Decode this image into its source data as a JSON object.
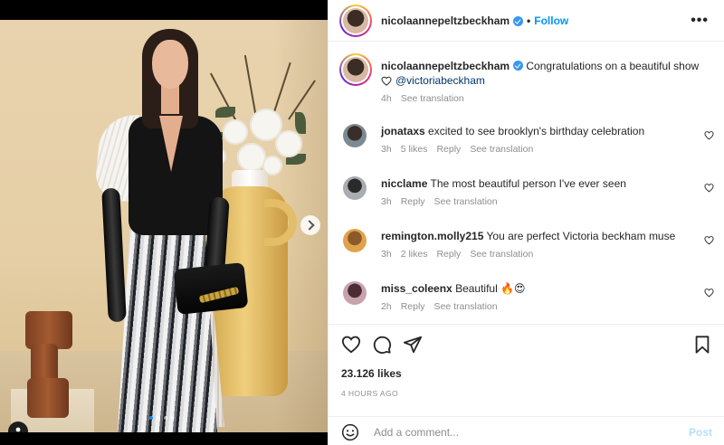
{
  "post": {
    "author": "nicolaannepeltzbeckham",
    "follow_label": "Follow",
    "separator": "•",
    "more_label": "•••",
    "carousel": {
      "total_slides": 4,
      "active_slide": 1
    }
  },
  "caption": {
    "username": "nicolaannepeltzbeckham",
    "text": "Congratulations on a beautiful show",
    "mention": "@victoriabeckham",
    "time": "4h",
    "see_translation": "See translation"
  },
  "comments": [
    {
      "username": "jonataxs",
      "text": "excited to see brooklyn's birthday celebration",
      "time": "3h",
      "likes": "5 likes",
      "reply": "Reply",
      "see_translation": "See translation"
    },
    {
      "username": "nicclame",
      "text": "The most beautiful person I've ever seen",
      "time": "3h",
      "reply": "Reply",
      "see_translation": "See translation"
    },
    {
      "username": "remington.molly215",
      "text": "You are perfect Victoria beckham muse",
      "time": "3h",
      "likes": "2 likes",
      "reply": "Reply",
      "see_translation": "See translation"
    },
    {
      "username": "miss_coleenx",
      "text": "Beautiful 🔥😍",
      "time": "2h",
      "reply": "Reply",
      "see_translation": "See translation"
    }
  ],
  "stats": {
    "likes": "23.126 likes",
    "time_ago": "4 HOURS AGO"
  },
  "composer": {
    "placeholder": "Add a comment...",
    "post_label": "Post"
  },
  "icons": [
    "heart-icon",
    "comment-icon",
    "share-icon",
    "bookmark-icon",
    "emoji-icon",
    "user-tag-icon",
    "chevron-right-icon",
    "verified-badge-icon",
    "more-icon"
  ],
  "colors": {
    "link": "#0095f6",
    "muted": "#8e8e8e",
    "verified": "#3897f0",
    "post_disabled": "#b2dffc"
  }
}
